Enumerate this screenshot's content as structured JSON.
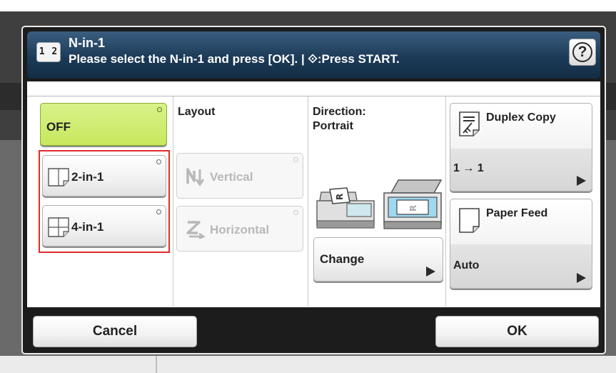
{
  "dialog": {
    "title": "N-in-1",
    "subtitle": "Please select the N-in-1 and press [OK]. | ⟐:Press START.",
    "title_icon": "1 2",
    "help_label": "?"
  },
  "n_in_1": {
    "off_label": "OFF",
    "two_in_one_label": "2-in-1",
    "four_in_one_label": "4-in-1",
    "selected": "OFF"
  },
  "layout": {
    "heading": "Layout",
    "vertical_label": "Vertical",
    "horizontal_label": "Horizontal"
  },
  "direction": {
    "heading": "Direction:",
    "value": "Portrait",
    "change_label": "Change"
  },
  "duplex": {
    "label": "Duplex Copy",
    "value": "1 → 1"
  },
  "paper_feed": {
    "label": "Paper Feed",
    "value": "Auto"
  },
  "footer": {
    "cancel_label": "Cancel",
    "ok_label": "OK"
  },
  "colors": {
    "selected_green": "#c7e85e",
    "highlight_red": "#e12c2c",
    "title_blue": "#1c3b58"
  }
}
